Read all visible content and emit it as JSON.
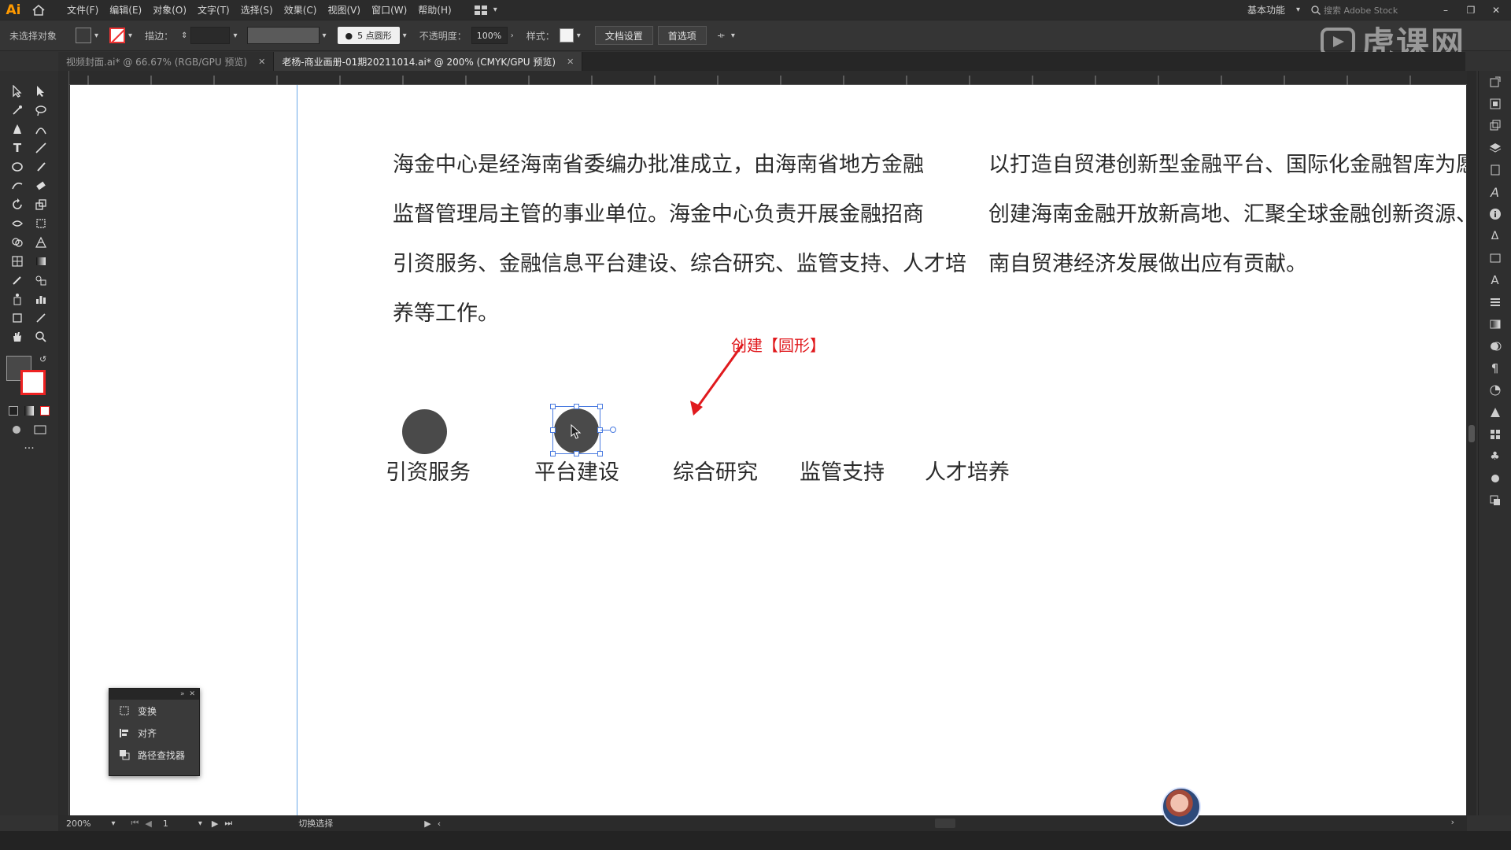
{
  "app": {
    "logo": "Ai"
  },
  "menu": {
    "items": [
      "文件(F)",
      "编辑(E)",
      "对象(O)",
      "文字(T)",
      "选择(S)",
      "效果(C)",
      "视图(V)",
      "窗口(W)",
      "帮助(H)"
    ],
    "workspace": "基本功能",
    "search_placeholder": "搜索 Adobe Stock"
  },
  "control_bar": {
    "selection_label": "未选择对象",
    "stroke_label": "描边：",
    "brush": "5 点圆形",
    "opacity_label": "不透明度：",
    "opacity_value": "100%",
    "style_label": "样式：",
    "doc_setup_button": "文档设置",
    "prefs_button": "首选项"
  },
  "watermark": "虎课网",
  "tabs": [
    {
      "label": "视频封面.ai* @ 66.67% (RGB/GPU 预览)",
      "active": false
    },
    {
      "label": "老杨-商业画册-01期20211014.ai* @ 200% (CMYK/GPU 预览)",
      "active": true
    }
  ],
  "canvas": {
    "paragraph_left": [
      "海金中心是经海南省委编办批准成立，由海南省地方金融",
      "监督管理局主管的事业单位。海金中心负责开展金融招商",
      "引资服务、金融信息平台建设、综合研究、监管支持、人才培",
      "养等工作。"
    ],
    "paragraph_right": [
      "以打造自贸港创新型金融平台、国际化金融智库为愿",
      "创建海南金融开放新高地、汇聚全球金融创新资源、",
      "南自贸港经济发展做出应有贡献。"
    ],
    "annotation": "创建【圆形】",
    "labels": [
      "引资服务",
      "平台建设",
      "综合研究",
      "监管支持",
      "人才培养"
    ],
    "circle_color": "#4a4a4a",
    "annotation_color": "#e0191d"
  },
  "float_panel": {
    "items": [
      "变换",
      "对齐",
      "路径查找器"
    ]
  },
  "status_bar": {
    "zoom": "200%",
    "artboard": "1",
    "mode": "切换选择"
  }
}
